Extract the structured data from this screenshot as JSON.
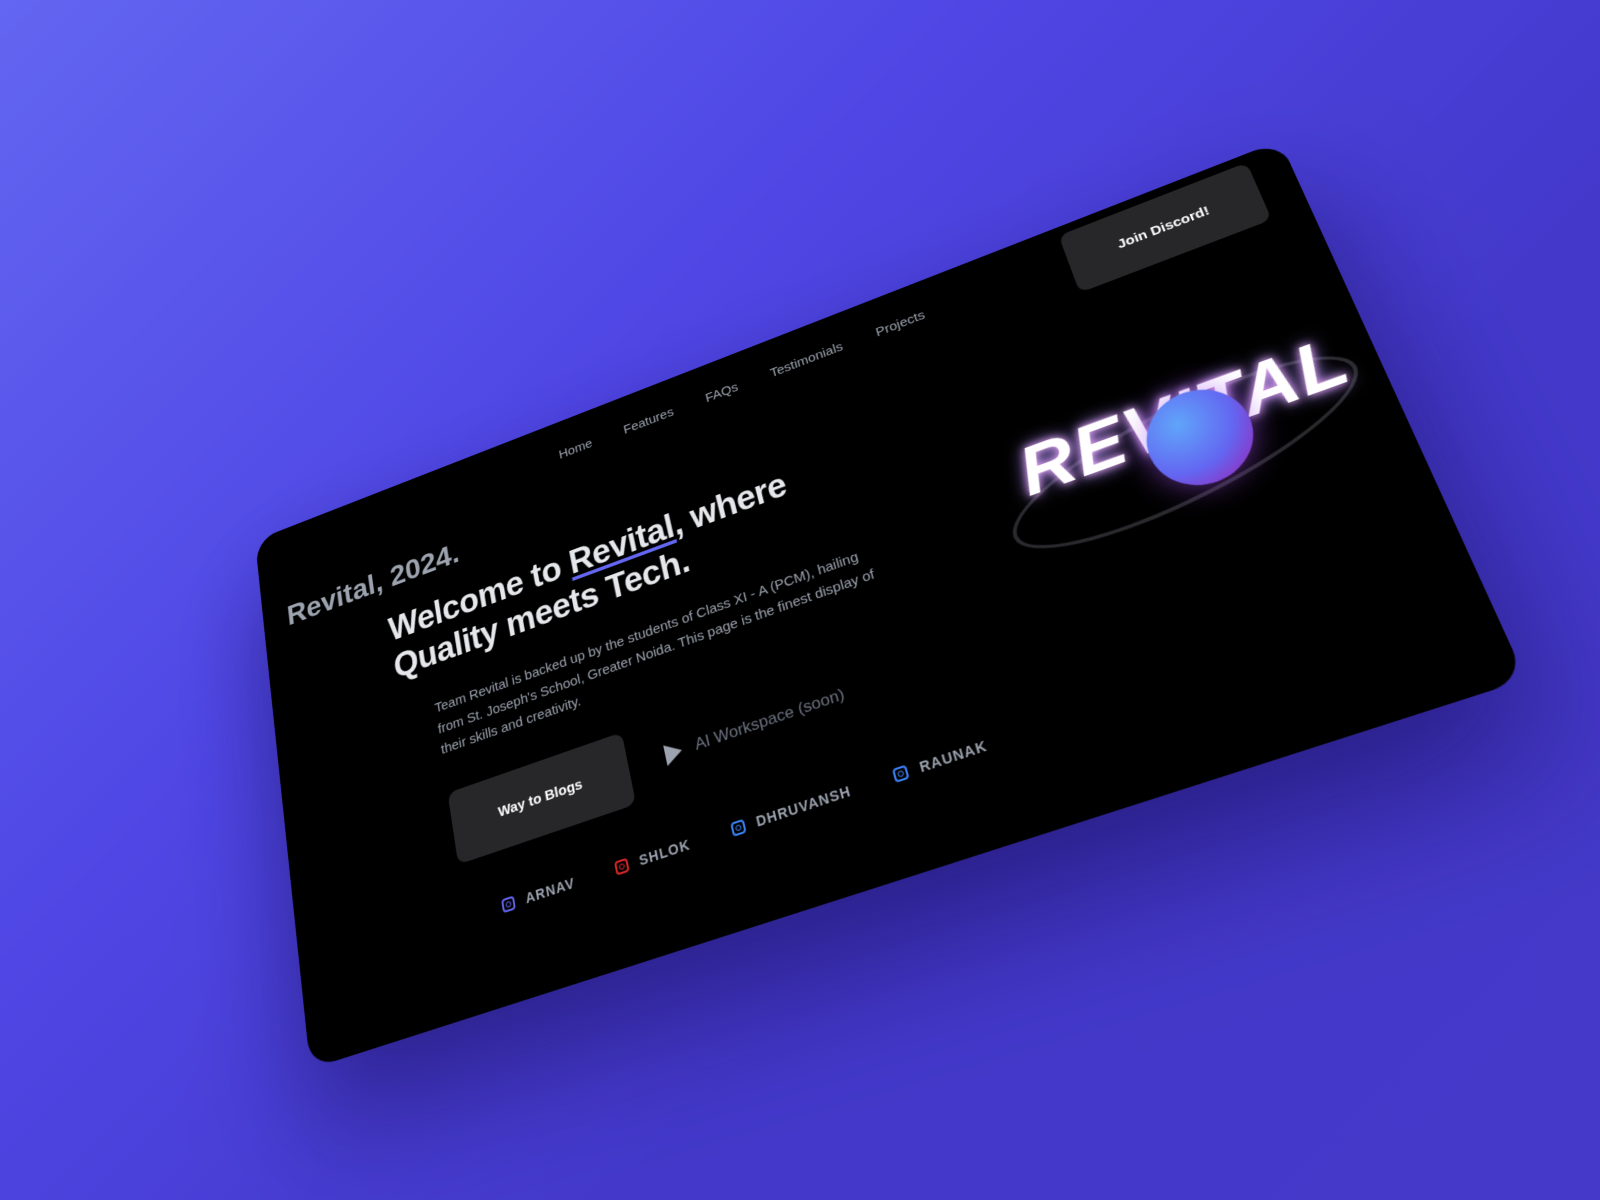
{
  "brand": "Revital, 2024.",
  "nav": {
    "items": [
      "Home",
      "Features",
      "FAQs",
      "Testimonials",
      "Projects"
    ]
  },
  "discord_button": "Join Discord!",
  "hero": {
    "title_prefix": "Welcome to ",
    "title_highlight": "Revital",
    "title_suffix": ", where Quality meets Tech.",
    "description": "Team Revital is backed up by the students of Class XI - A (PCM), hailing from St. Joseph's School, Greater Noida. This page is the finest display of their skills and creativity.",
    "blogs_button": "Way to Blogs",
    "workspace_label": "AI Workspace (soon)"
  },
  "socials": [
    {
      "name": "ARNAV",
      "icon": "instagram-icon",
      "color": "#6366f1"
    },
    {
      "name": "SHLOK",
      "icon": "instagram-icon",
      "color": "#dc2626"
    },
    {
      "name": "DHRUVANSH",
      "icon": "instagram-icon",
      "color": "#3b82f6"
    },
    {
      "name": "RAUNAK",
      "icon": "instagram-icon",
      "color": "#3b82f6"
    }
  ],
  "logo": {
    "text": "REVITAL"
  },
  "colors": {
    "background": "#4f46e5",
    "card": "#000000",
    "button": "#27272a",
    "accent": "#6366f1"
  }
}
